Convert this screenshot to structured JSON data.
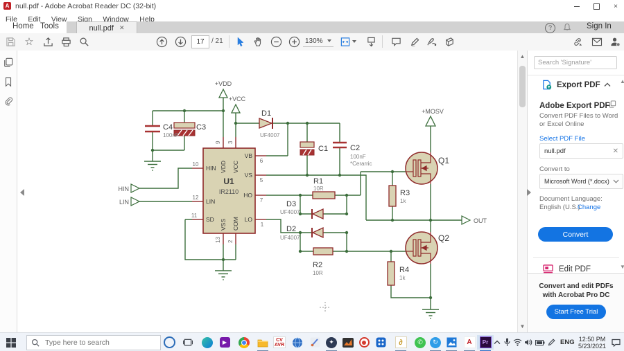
{
  "window": {
    "title": "null.pdf - Adobe Acrobat Reader DC (32-bit)"
  },
  "menu": {
    "items": [
      "File",
      "Edit",
      "View",
      "Sign",
      "Window",
      "Help"
    ]
  },
  "tabs": {
    "home": "Home",
    "tools": "Tools",
    "document": "null.pdf",
    "signin": "Sign In"
  },
  "toolbar": {
    "page": "17",
    "page_total": "/ 21",
    "zoom": "130%"
  },
  "sidebar": {
    "search_placeholder": "Search 'Signature'",
    "export": {
      "title": "Export PDF",
      "heading": "Adobe Export PDF",
      "desc1": "Convert PDF Files to Word",
      "desc2": "or Excel Online",
      "select_link": "Select PDF File",
      "file": "null.pdf",
      "convert_to": "Convert to",
      "format": "Microsoft Word (*.docx)",
      "language_label": "Document Language:",
      "language": "English (U.S.)",
      "change": "Change",
      "convert_button": "Convert"
    },
    "edit": {
      "title": "Edit PDF"
    },
    "promo": {
      "line1": "Convert and edit PDFs",
      "line2": "with Acrobat Pro DC",
      "button": "Start Free Trial"
    }
  },
  "doc": {
    "nets": {
      "vdd": "+VDD",
      "vcc": "+VCC",
      "mosv": "+MOSV",
      "out": "OUT",
      "hin": "HIN",
      "lin": "LIN"
    },
    "u1": {
      "ref": "U1",
      "part": "IR2110",
      "pins": {
        "hin": [
          "HIN",
          "10"
        ],
        "lin": [
          "LIN",
          "12"
        ],
        "sd": [
          "SD",
          "11"
        ],
        "vdd": [
          "VDD",
          "9"
        ],
        "vcc": [
          "VCC",
          "3"
        ],
        "vb": [
          "VB",
          "6"
        ],
        "vs": [
          "VS",
          "5"
        ],
        "ho": [
          "HO",
          "7"
        ],
        "lo": [
          "LO",
          "1"
        ],
        "vss": [
          "VSS",
          "13"
        ],
        "com": [
          "COM",
          "2"
        ]
      }
    },
    "parts": {
      "c4": [
        "C4",
        "100nF"
      ],
      "c3": [
        "C3"
      ],
      "c1": [
        "C1"
      ],
      "c2": [
        "C2",
        "100nF",
        "*Cerarric"
      ],
      "d1": [
        "D1",
        "UF4007"
      ],
      "d3": [
        "D3",
        "UF4007"
      ],
      "d2": [
        "D2",
        "UF4007"
      ],
      "r1": [
        "R1",
        "10R"
      ],
      "r2": [
        "R2",
        "10R"
      ],
      "r3": [
        "R3",
        "1k"
      ],
      "r4": [
        "R4",
        "1k"
      ],
      "q1": [
        "Q1"
      ],
      "q2": [
        "Q2"
      ]
    }
  },
  "taskbar": {
    "search_placeholder": "Type here to search",
    "lang": "ENG",
    "time": "12:50 PM",
    "date": "5/23/2021",
    "pinned_apps": [
      "edge",
      "media-player",
      "chrome",
      "file-explorer",
      "cvavr",
      "globe-browser",
      "design-tool",
      "proteus",
      "matlab",
      "screen-recorder",
      "blue-grid-app",
      "gold-app",
      "whatsapp",
      "shareit",
      "photos",
      "acrobat",
      "premiere"
    ]
  }
}
